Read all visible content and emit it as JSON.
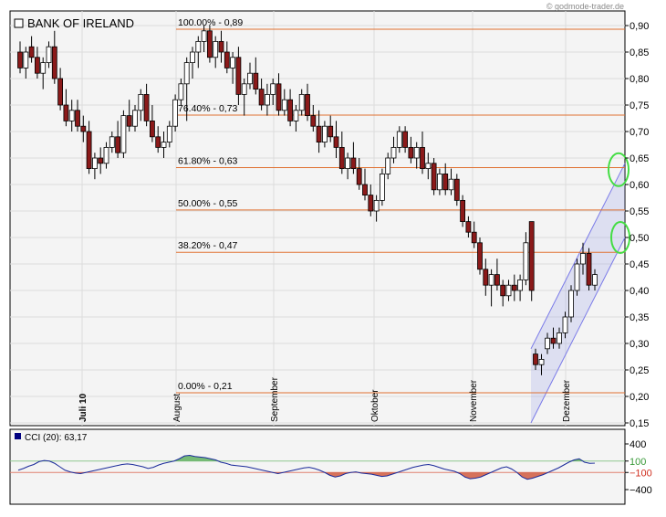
{
  "watermark": "© godmode-trader.de",
  "chart_data": [
    {
      "type": "candlestick",
      "title": "BANK OF IRELAND",
      "ylim": [
        0.15,
        0.9
      ],
      "yticks": [
        "0,90",
        "0,85",
        "0,80",
        "0,75",
        "0,70",
        "0,65",
        "0,60",
        "0,55",
        "0,50",
        "0,45",
        "0,40",
        "0,35",
        "0,30",
        "0,25",
        "0,20",
        "0,15"
      ],
      "month_labels": [
        "Juli 10",
        "August",
        "September",
        "Oktober",
        "November",
        "Dezember"
      ],
      "fib_levels": [
        {
          "label": "100.00% - 0,89",
          "value": 0.893
        },
        {
          "label": "76.40% - 0,73",
          "value": 0.731
        },
        {
          "label": "61.80% - 0,63",
          "value": 0.632
        },
        {
          "label": "50.00% - 0,55",
          "value": 0.552
        },
        {
          "label": "38.20% - 0,47",
          "value": 0.472
        },
        {
          "label": "0.00% - 0,21",
          "value": 0.207
        }
      ],
      "channel": {
        "lower": [
          [
            0.152,
            0.5
          ],
          [
            0.0,
            0.0
          ]
        ],
        "note": "rising channel, shaded"
      },
      "markers": [
        "green ellipse at 0,63",
        "green ellipse at 0,50"
      ],
      "candles": [
        [
          0.85,
          0.87,
          0.81,
          0.82
        ],
        [
          0.82,
          0.86,
          0.8,
          0.85
        ],
        [
          0.86,
          0.88,
          0.83,
          0.84
        ],
        [
          0.84,
          0.86,
          0.8,
          0.81
        ],
        [
          0.81,
          0.84,
          0.78,
          0.83
        ],
        [
          0.83,
          0.87,
          0.82,
          0.86
        ],
        [
          0.86,
          0.89,
          0.79,
          0.8
        ],
        [
          0.8,
          0.82,
          0.74,
          0.75
        ],
        [
          0.75,
          0.78,
          0.71,
          0.72
        ],
        [
          0.72,
          0.76,
          0.7,
          0.74
        ],
        [
          0.74,
          0.76,
          0.7,
          0.71
        ],
        [
          0.71,
          0.73,
          0.68,
          0.7
        ],
        [
          0.7,
          0.72,
          0.62,
          0.63
        ],
        [
          0.63,
          0.66,
          0.61,
          0.65
        ],
        [
          0.65,
          0.67,
          0.62,
          0.64
        ],
        [
          0.64,
          0.68,
          0.63,
          0.67
        ],
        [
          0.67,
          0.7,
          0.66,
          0.69
        ],
        [
          0.69,
          0.72,
          0.65,
          0.66
        ],
        [
          0.66,
          0.74,
          0.65,
          0.73
        ],
        [
          0.73,
          0.76,
          0.7,
          0.71
        ],
        [
          0.71,
          0.75,
          0.7,
          0.74
        ],
        [
          0.74,
          0.78,
          0.72,
          0.77
        ],
        [
          0.77,
          0.79,
          0.71,
          0.72
        ],
        [
          0.72,
          0.75,
          0.68,
          0.69
        ],
        [
          0.69,
          0.71,
          0.66,
          0.67
        ],
        [
          0.67,
          0.7,
          0.65,
          0.68
        ],
        [
          0.68,
          0.72,
          0.67,
          0.71
        ],
        [
          0.71,
          0.77,
          0.7,
          0.76
        ],
        [
          0.76,
          0.8,
          0.75,
          0.79
        ],
        [
          0.79,
          0.84,
          0.72,
          0.83
        ],
        [
          0.83,
          0.86,
          0.8,
          0.85
        ],
        [
          0.85,
          0.88,
          0.82,
          0.87
        ],
        [
          0.87,
          0.9,
          0.85,
          0.89
        ],
        [
          0.89,
          0.9,
          0.83,
          0.84
        ],
        [
          0.84,
          0.88,
          0.82,
          0.87
        ],
        [
          0.87,
          0.89,
          0.83,
          0.85
        ],
        [
          0.85,
          0.87,
          0.81,
          0.82
        ],
        [
          0.82,
          0.85,
          0.79,
          0.84
        ],
        [
          0.84,
          0.86,
          0.75,
          0.77
        ],
        [
          0.77,
          0.8,
          0.73,
          0.79
        ],
        [
          0.79,
          0.83,
          0.78,
          0.81
        ],
        [
          0.81,
          0.84,
          0.77,
          0.78
        ],
        [
          0.78,
          0.8,
          0.74,
          0.75
        ],
        [
          0.75,
          0.79,
          0.73,
          0.77
        ],
        [
          0.77,
          0.8,
          0.75,
          0.79
        ],
        [
          0.79,
          0.81,
          0.73,
          0.74
        ],
        [
          0.74,
          0.78,
          0.73,
          0.76
        ],
        [
          0.76,
          0.78,
          0.71,
          0.72
        ],
        [
          0.72,
          0.75,
          0.7,
          0.74
        ],
        [
          0.74,
          0.78,
          0.73,
          0.77
        ],
        [
          0.77,
          0.79,
          0.72,
          0.73
        ],
        [
          0.73,
          0.75,
          0.7,
          0.71
        ],
        [
          0.71,
          0.74,
          0.66,
          0.68
        ],
        [
          0.68,
          0.72,
          0.67,
          0.71
        ],
        [
          0.71,
          0.73,
          0.68,
          0.69
        ],
        [
          0.69,
          0.72,
          0.65,
          0.67
        ],
        [
          0.67,
          0.7,
          0.62,
          0.63
        ],
        [
          0.63,
          0.66,
          0.61,
          0.65
        ],
        [
          0.65,
          0.68,
          0.62,
          0.63
        ],
        [
          0.63,
          0.65,
          0.59,
          0.6
        ],
        [
          0.6,
          0.63,
          0.57,
          0.58
        ],
        [
          0.58,
          0.6,
          0.54,
          0.55
        ],
        [
          0.55,
          0.58,
          0.53,
          0.57
        ],
        [
          0.57,
          0.63,
          0.56,
          0.62
        ],
        [
          0.62,
          0.66,
          0.61,
          0.65
        ],
        [
          0.65,
          0.69,
          0.64,
          0.67
        ],
        [
          0.67,
          0.71,
          0.66,
          0.7
        ],
        [
          0.7,
          0.71,
          0.66,
          0.67
        ],
        [
          0.67,
          0.69,
          0.64,
          0.65
        ],
        [
          0.65,
          0.68,
          0.63,
          0.67
        ],
        [
          0.67,
          0.7,
          0.62,
          0.63
        ],
        [
          0.63,
          0.66,
          0.61,
          0.64
        ],
        [
          0.64,
          0.65,
          0.58,
          0.59
        ],
        [
          0.59,
          0.63,
          0.58,
          0.62
        ],
        [
          0.62,
          0.64,
          0.58,
          0.59
        ],
        [
          0.59,
          0.63,
          0.58,
          0.61
        ],
        [
          0.61,
          0.62,
          0.56,
          0.57
        ],
        [
          0.57,
          0.58,
          0.52,
          0.53
        ],
        [
          0.53,
          0.54,
          0.5,
          0.51
        ],
        [
          0.51,
          0.53,
          0.48,
          0.49
        ],
        [
          0.49,
          0.5,
          0.43,
          0.44
        ],
        [
          0.44,
          0.46,
          0.39,
          0.41
        ],
        [
          0.41,
          0.44,
          0.37,
          0.43
        ],
        [
          0.43,
          0.46,
          0.4,
          0.41
        ],
        [
          0.41,
          0.42,
          0.37,
          0.39
        ],
        [
          0.39,
          0.42,
          0.38,
          0.41
        ],
        [
          0.41,
          0.43,
          0.38,
          0.4
        ],
        [
          0.4,
          0.43,
          0.38,
          0.42
        ],
        [
          0.42,
          0.51,
          0.41,
          0.49
        ],
        [
          0.53,
          0.53,
          0.38,
          0.4
        ],
        [
          0.28,
          0.29,
          0.25,
          0.26
        ],
        [
          0.26,
          0.28,
          0.24,
          0.27
        ],
        [
          0.29,
          0.32,
          0.28,
          0.31
        ],
        [
          0.31,
          0.33,
          0.29,
          0.3
        ],
        [
          0.3,
          0.33,
          0.29,
          0.32
        ],
        [
          0.32,
          0.36,
          0.31,
          0.35
        ],
        [
          0.35,
          0.41,
          0.34,
          0.4
        ],
        [
          0.4,
          0.46,
          0.39,
          0.45
        ],
        [
          0.45,
          0.49,
          0.43,
          0.47
        ],
        [
          0.47,
          0.48,
          0.4,
          0.41
        ],
        [
          0.41,
          0.44,
          0.4,
          0.43
        ]
      ]
    },
    {
      "type": "line",
      "title": "CCI (20): 63,17",
      "ylim": [
        -480,
        480
      ],
      "yticks": [
        "400",
        "100",
        "-100",
        "-400"
      ],
      "reference_lines": [
        100,
        -100
      ],
      "values": [
        -60,
        -30,
        10,
        40,
        90,
        110,
        100,
        60,
        0,
        -60,
        -90,
        -110,
        -120,
        -100,
        -80,
        -60,
        -40,
        -20,
        0,
        20,
        40,
        50,
        40,
        20,
        0,
        -30,
        -10,
        30,
        60,
        80,
        100,
        140,
        190,
        200,
        180,
        170,
        160,
        140,
        120,
        80,
        60,
        30,
        20,
        10,
        0,
        -20,
        -40,
        -60,
        -80,
        -100,
        -120,
        -100,
        -80,
        -60,
        -40,
        -20,
        -10,
        -30,
        -60,
        -100,
        -150,
        -180,
        -160,
        -120,
        -100,
        -90,
        -110,
        -120,
        -130,
        -150,
        -170,
        -160,
        -130,
        -100,
        -70,
        -40,
        -10,
        10,
        30,
        40,
        20,
        -10,
        -40,
        -60,
        -80,
        -120,
        -180,
        -210,
        -200,
        -180,
        -140,
        -100,
        -60,
        -20,
        0,
        -40,
        -100,
        -180,
        -220,
        -200,
        -170,
        -140,
        -100,
        -60,
        -20,
        30,
        80,
        120,
        140,
        80,
        60,
        63
      ]
    }
  ]
}
